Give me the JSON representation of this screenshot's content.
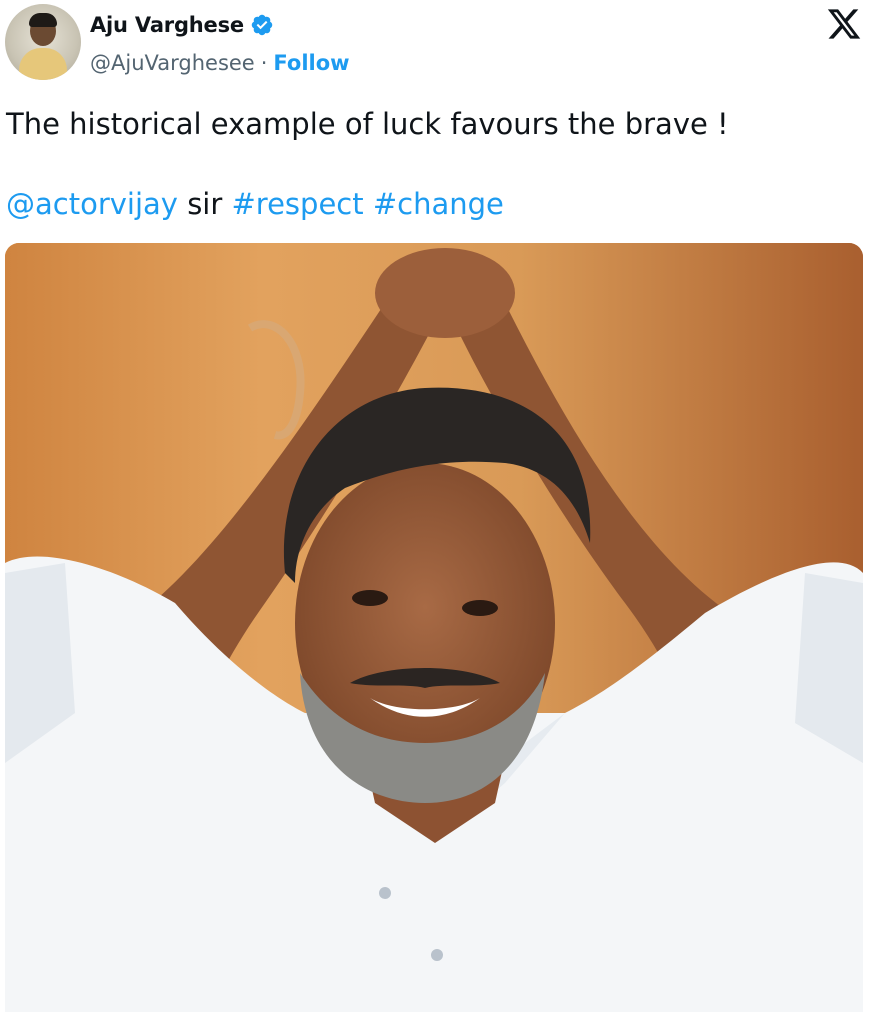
{
  "author": {
    "name": "Aju Varghese",
    "handle": "@AjuVarghesee",
    "separator": "·",
    "follow_label": "Follow",
    "verified_icon": "verified-badge-icon",
    "avatar_icon": "avatar"
  },
  "platform_icon": "x-logo-icon",
  "tweet": {
    "text": "The historical example of luck favours the brave !",
    "mention": "@actorvijay",
    "word": "sir",
    "hashtag1": "#respect",
    "hashtag2": "#change"
  },
  "media": {
    "description_icon": "photo"
  },
  "colors": {
    "link": "#1d9bf0",
    "text": "#0f1419",
    "secondary": "#536471",
    "background": "#ffffff"
  }
}
